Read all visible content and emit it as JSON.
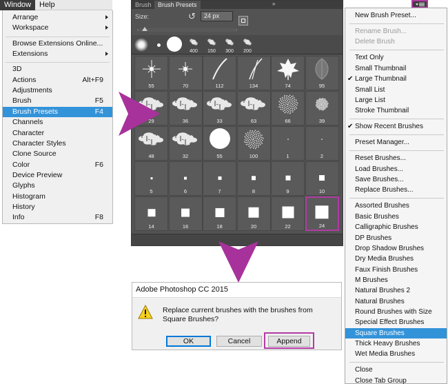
{
  "window_menu": {
    "menubar": [
      "Window",
      "Help"
    ],
    "items": [
      {
        "label": "Arrange",
        "submenu": true
      },
      {
        "label": "Workspace",
        "submenu": true
      },
      {
        "separator": true
      },
      {
        "label": "Browse Extensions Online..."
      },
      {
        "label": "Extensions",
        "submenu": true
      },
      {
        "separator": true
      },
      {
        "label": "3D"
      },
      {
        "label": "Actions",
        "shortcut": "Alt+F9"
      },
      {
        "label": "Adjustments"
      },
      {
        "label": "Brush",
        "shortcut": "F5"
      },
      {
        "label": "Brush Presets",
        "shortcut": "F4",
        "highlighted": true
      },
      {
        "label": "Channels"
      },
      {
        "label": "Character"
      },
      {
        "label": "Character Styles"
      },
      {
        "label": "Clone Source"
      },
      {
        "label": "Color",
        "shortcut": "F6"
      },
      {
        "label": "Device Preview"
      },
      {
        "label": "Glyphs"
      },
      {
        "label": "Histogram"
      },
      {
        "label": "History"
      },
      {
        "label": "Info",
        "shortcut": "F8"
      }
    ]
  },
  "panel": {
    "tabs": [
      "Brush",
      "Brush Presets"
    ],
    "double_arrow": "»",
    "size_label": "Size:",
    "size_value": "24 px",
    "strip_labels": [
      "400",
      "150",
      "300",
      "200"
    ],
    "rows": [
      {
        "labels": [
          "55",
          "70",
          "112",
          "134",
          "74",
          "95"
        ],
        "icons": [
          "star-burst",
          "star-burst-small",
          "grass-blade",
          "grass-blades",
          "maple-leaf",
          "leaf-outline"
        ]
      },
      {
        "labels": [
          "29",
          "36",
          "33",
          "63",
          "66",
          "39"
        ],
        "icons": [
          "texture",
          "texture",
          "texture",
          "texture",
          "spray",
          "spray-small"
        ]
      },
      {
        "labels": [
          "48",
          "32",
          "55",
          "100",
          "1",
          "2"
        ],
        "icons": [
          "texture",
          "texture",
          "hard-round",
          "spray",
          "dot",
          "dot"
        ]
      },
      {
        "labels": [
          "5",
          "6",
          "7",
          "8",
          "9",
          "10"
        ],
        "sizes": [
          3,
          4,
          5,
          6,
          7,
          8
        ]
      },
      {
        "labels": [
          "14",
          "16",
          "18",
          "20",
          "22",
          "24"
        ],
        "sizes": [
          11,
          12,
          13,
          15,
          17,
          19
        ]
      }
    ]
  },
  "flyout": {
    "items": [
      {
        "label": "New Brush Preset..."
      },
      {
        "separator": true
      },
      {
        "label": "Rename Brush...",
        "disabled": true
      },
      {
        "label": "Delete Brush",
        "disabled": true
      },
      {
        "separator": true
      },
      {
        "label": "Text Only"
      },
      {
        "label": "Small Thumbnail"
      },
      {
        "label": "Large Thumbnail",
        "checked": true
      },
      {
        "label": "Small List"
      },
      {
        "label": "Large List"
      },
      {
        "label": "Stroke Thumbnail"
      },
      {
        "separator": true
      },
      {
        "label": "Show Recent Brushes",
        "checked": true
      },
      {
        "separator": true
      },
      {
        "label": "Preset Manager..."
      },
      {
        "separator": true
      },
      {
        "label": "Reset Brushes..."
      },
      {
        "label": "Load Brushes..."
      },
      {
        "label": "Save Brushes..."
      },
      {
        "label": "Replace Brushes..."
      },
      {
        "separator": true
      },
      {
        "label": "Assorted Brushes"
      },
      {
        "label": "Basic Brushes"
      },
      {
        "label": "Calligraphic Brushes"
      },
      {
        "label": "DP Brushes"
      },
      {
        "label": "Drop Shadow Brushes"
      },
      {
        "label": "Dry Media Brushes"
      },
      {
        "label": "Faux Finish Brushes"
      },
      {
        "label": "M Brushes"
      },
      {
        "label": "Natural Brushes 2"
      },
      {
        "label": "Natural Brushes"
      },
      {
        "label": "Round Brushes with Size"
      },
      {
        "label": "Special Effect Brushes"
      },
      {
        "label": "Square Brushes",
        "highlighted": true
      },
      {
        "label": "Thick Heavy Brushes"
      },
      {
        "label": "Wet Media Brushes"
      },
      {
        "separator": true
      },
      {
        "label": "Close"
      },
      {
        "label": "Close Tab Group"
      }
    ]
  },
  "dialog": {
    "title": "Adobe Photoshop CC 2015",
    "message": "Replace current brushes with the brushes from Square Brushes?",
    "buttons": {
      "ok": "OK",
      "cancel": "Cancel",
      "append": "Append"
    }
  },
  "colors": {
    "highlight": "#3393d9",
    "callout": "#b23aa3",
    "panel_bg": "#535353"
  }
}
